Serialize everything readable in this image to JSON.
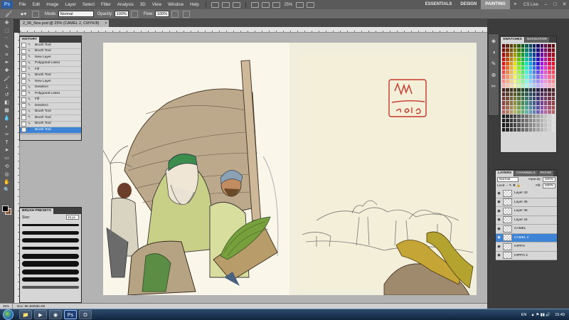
{
  "menubar": {
    "logo": "Ps",
    "items": [
      "File",
      "Edit",
      "Image",
      "Layer",
      "Select",
      "Filter",
      "Analysis",
      "3D",
      "View",
      "Window",
      "Help"
    ],
    "zoom": "25%",
    "workspaces": [
      "ESSENTIALS",
      "DESIGN",
      "PAINTING"
    ],
    "active_workspace": "PAINTING",
    "cslive": "CS Live",
    "win_controls": [
      "–",
      "□",
      "✕"
    ]
  },
  "options": {
    "mode_label": "Mode:",
    "mode_value": "Normal",
    "opacity_label": "Opacity:",
    "opacity_value": "100%",
    "flow_label": "Flow:",
    "flow_value": "100%"
  },
  "document": {
    "tab_title": "2_06_Noe.psd @ 25% (CAMEL 2, CMYK/8)",
    "close": "×"
  },
  "history": {
    "tab": "HISTORY",
    "items": [
      "Brush Tool",
      "Brush Tool",
      "New Layer",
      "Polygonal Lasso",
      "Fill",
      "Brush Tool",
      "New Layer",
      "Deselect",
      "Polygonal Lasso",
      "Fill",
      "Deselect",
      "Brush Tool",
      "Brush Tool",
      "Brush Tool",
      "Brush Tool"
    ],
    "selected_index": 14
  },
  "brushes": {
    "tab": "BRUSH PRESETS",
    "size_label": "Size:",
    "size_value": "15 px"
  },
  "swatches": {
    "tabs": [
      "SWATCHES",
      "NAVIGATOR"
    ]
  },
  "layers": {
    "tabs": [
      "LAYERS",
      "CHANNELS",
      "PATHS"
    ],
    "blend_mode": "Normal",
    "opacity_label": "Opacity:",
    "opacity_value": "100%",
    "lock_label": "Lock:",
    "fill_label": "Fill:",
    "fill_value": "100%",
    "rows": [
      {
        "name": "Layer 33"
      },
      {
        "name": "Layer 35"
      },
      {
        "name": "Layer 36"
      },
      {
        "name": "Layer 34"
      },
      {
        "name": "CAMEL"
      },
      {
        "name": "CAMEL 2"
      },
      {
        "name": "HIPPO"
      },
      {
        "name": "HIPPO 2"
      }
    ],
    "selected_index": 5
  },
  "statusbar": {
    "zoom": "25%",
    "doc": "Doc: 96.4M/835.2M"
  },
  "artwork": {
    "signature_initials": "MW",
    "signature_year": "2015"
  },
  "taskbar": {
    "lang": "EN",
    "time": "15:49"
  },
  "colors": {
    "accent": "#3d84d6",
    "menubar": "#5a5a5a",
    "panel": "#d6d6d6",
    "signature": "#c6372b"
  }
}
